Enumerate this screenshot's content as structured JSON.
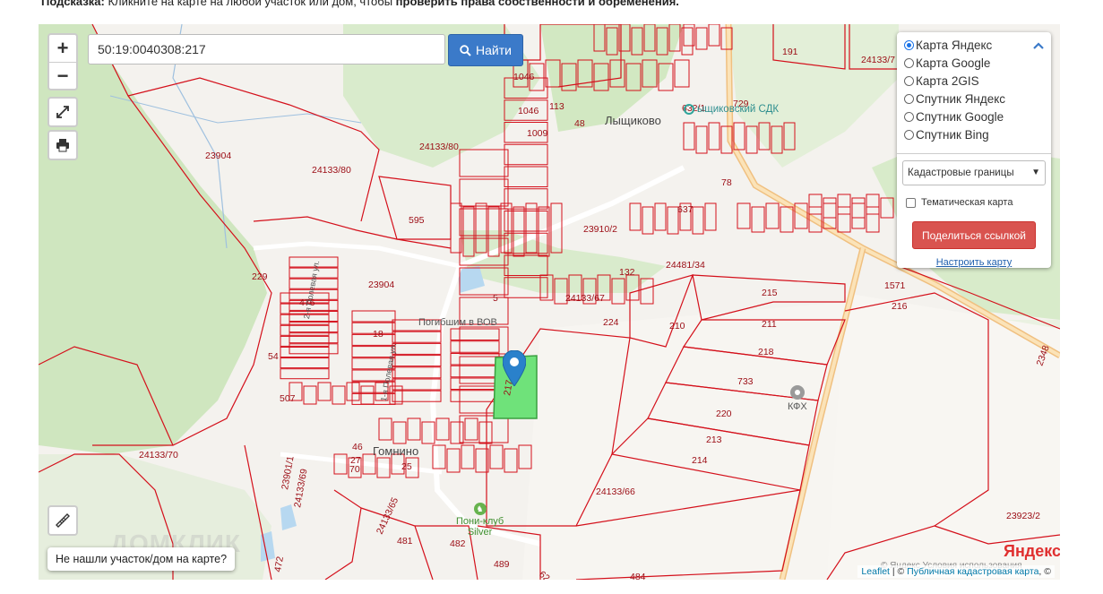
{
  "hint": {
    "prefix": "Подсказка:",
    "text": " Кликните на карте на любой участок или дом, чтобы ",
    "bold": "проверить права собственности и обременения."
  },
  "search": {
    "value": "50:19:0040308:217",
    "button_label": "Найти"
  },
  "zoom": {
    "in": "+",
    "out": "−"
  },
  "layers": {
    "options": [
      "Карта Яндекс",
      "Карта Google",
      "Карта 2GIS",
      "Спутник Яндекс",
      "Спутник Google",
      "Спутник Bing"
    ],
    "selected_index": 0,
    "select_value": "Кадастровые границы",
    "thematic_label": "Тематическая карта",
    "share_label": "Поделиться ссылкой",
    "configure_label": "Настроить карту"
  },
  "not_found_label": "Не нашли участок/дом на карте?",
  "attribution": {
    "leaflet": "Leaflet",
    "sep": " | © ",
    "cadastre": "Публичная кадастровая карта",
    "tail": ", ©"
  },
  "map_texts": {
    "yandex_logo": "Яндекс",
    "copyright": "© Яндекс Условия использования",
    "village_lyshchikovo": "Лыщиково",
    "village_gomnino": "Гомнино",
    "village_lyshchikovo_mark": "ыщиковский СДК",
    "memorial": "Погибшим в ВОВ",
    "pony_club": "Пони-клуб",
    "pony_club_2": "Silver",
    "kfh": "КФХ",
    "street_1": "1-я Полевая ул.",
    "street_2": "2-я Полевая ул.",
    "watermark": "ДОМКЛИК",
    "parcel_labels": [
      {
        "t": "23904"
      },
      {
        "t": "24133/80"
      },
      {
        "t": "24133/80"
      },
      {
        "t": "23904"
      },
      {
        "t": "595"
      },
      {
        "t": "23910/2"
      },
      {
        "t": "24481/34"
      },
      {
        "t": "24133/67"
      },
      {
        "t": "224"
      },
      {
        "t": "210"
      },
      {
        "t": "215"
      },
      {
        "t": "211"
      },
      {
        "t": "218"
      },
      {
        "t": "733"
      },
      {
        "t": "220"
      },
      {
        "t": "213"
      },
      {
        "t": "214"
      },
      {
        "t": "24133/66"
      },
      {
        "t": "24133/70"
      },
      {
        "t": "216"
      },
      {
        "t": "23923/2"
      },
      {
        "t": "24133/7"
      },
      {
        "t": "191"
      },
      {
        "t": "1046"
      },
      {
        "t": "1046"
      },
      {
        "t": "1009"
      },
      {
        "t": "113"
      },
      {
        "t": "48"
      },
      {
        "t": "729"
      },
      {
        "t": "632/1"
      },
      {
        "t": "78"
      },
      {
        "t": "637"
      },
      {
        "t": "132"
      },
      {
        "t": "229"
      },
      {
        "t": "476"
      },
      {
        "t": "18"
      },
      {
        "t": "54"
      },
      {
        "t": "507"
      },
      {
        "t": "46"
      },
      {
        "t": "27"
      },
      {
        "t": "70"
      },
      {
        "t": "25"
      },
      {
        "t": "23901/1"
      },
      {
        "t": "24133/69"
      },
      {
        "t": "24133/65"
      },
      {
        "t": "481"
      },
      {
        "t": "482"
      },
      {
        "t": "489"
      },
      {
        "t": "484"
      },
      {
        "t": "472"
      },
      {
        "t": "5"
      },
      {
        "t": "1571"
      },
      {
        "t": "2348"
      },
      {
        "t": "62"
      },
      {
        "t": "217"
      }
    ]
  }
}
